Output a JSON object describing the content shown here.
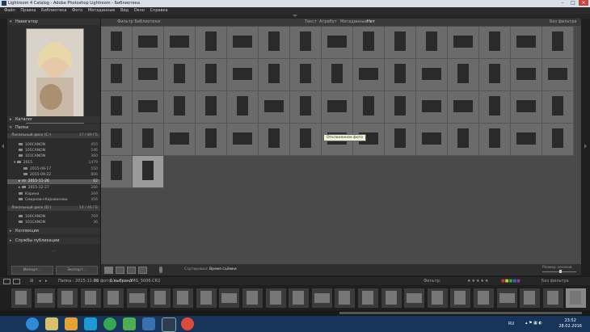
{
  "window": {
    "title": "Lightroom 4 Catalog - Adobe Photoshop Lightroom - Библиотека"
  },
  "menu": [
    "Файл",
    "Правка",
    "Библиотека",
    "Фото",
    "Метаданные",
    "Вид",
    "Окно",
    "Справка"
  ],
  "left_panel": {
    "navigator_label": "Навигатор",
    "catalog_label": "Каталог",
    "folders_label": "Папки",
    "disk1": {
      "label": "Локальный диск (C:)",
      "info": "17 / 89 ГБ"
    },
    "folders": [
      {
        "label": "100CANON",
        "count": "455"
      },
      {
        "label": "105CANON",
        "count": "546"
      },
      {
        "label": "101CANON",
        "count": "360"
      },
      {
        "label": "2015",
        "count": "1479"
      },
      {
        "label": "2015-09-17",
        "count": "550"
      },
      {
        "label": "2015-09-22",
        "count": "806"
      },
      {
        "label": "2015-11-26",
        "count": "62"
      },
      {
        "label": "2015-12-27",
        "count": "266"
      },
      {
        "label": "Карина",
        "count": "269"
      },
      {
        "label": "Смирнов+Караванова",
        "count": "456"
      }
    ],
    "disk2": {
      "label": "Локальный диск (D:)",
      "info": "14 / 46 ГБ"
    },
    "folders2": [
      {
        "label": "100CANON",
        "count": "769"
      },
      {
        "label": "101CANON",
        "count": "36"
      }
    ],
    "collections_label": "Коллекции",
    "publish_label": "Службы публикации",
    "import_button": "Импорт...",
    "export_button": "Экспорт..."
  },
  "filter_bar": {
    "left_label": "Фильтр Библиотеки:",
    "text": "Текст",
    "attribute": "Атрибут",
    "metadata": "Метаданные",
    "none": "Нет",
    "preset": "Без фильтра"
  },
  "tooltip": "Отклоненное фото",
  "toolbar": {
    "sort_label": "Сортировка:",
    "sort_value": "Время съёмки",
    "thumb_label": "Размер эскизов"
  },
  "filmstrip_bar": {
    "path": "Папка : 2015-11-26",
    "count": "62 фото /",
    "selected": "1 выбрано",
    "file": "/IMG_5006.CR2",
    "filter_label": "Фильтр:",
    "preset": "Без фильтра"
  },
  "taskbar": {
    "lang": "RU",
    "time": "23:52",
    "date": "28.02.2016"
  },
  "colors": {
    "taskbar": "#17345a",
    "grid_bg": "#4a4a4a",
    "panel_bg": "#2c2c2c"
  }
}
